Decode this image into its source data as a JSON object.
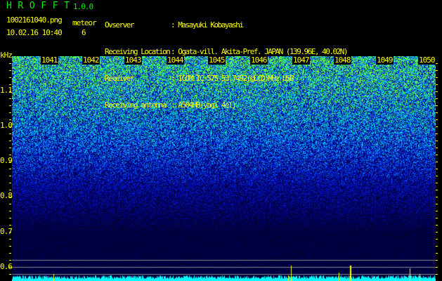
{
  "app": {
    "title": "HROFFT",
    "version": "1.0.0"
  },
  "file": {
    "name": "1002161040.png",
    "datetime": "10.02.16 10:40"
  },
  "meteor": {
    "label": "meteor",
    "count": "6"
  },
  "info": [
    {
      "key": "Ovserver",
      "value": ": Masayuki Kobayashi"
    },
    {
      "key": "Receiving Location",
      "value": ": Ogata-vill. Akita-Pref. JAPAN (139.96E, 40.02N)"
    },
    {
      "key": "Receiver",
      "value": ": ICOM IC-575 53.7492(@LCD)MHz USB"
    },
    {
      "key": "Receiving antenna",
      "value": ": A504HB(yagi 4el)"
    }
  ],
  "spectrogram": {
    "y_unit": "kHz",
    "y_ticks": [
      "1.1",
      "1.0",
      "0.9",
      "0.8",
      "0.7",
      "0.6"
    ],
    "time_labels": [
      "1041",
      "1042",
      "1043",
      "1044",
      "1045",
      "1046",
      "1047",
      "1048",
      "1049",
      "1050"
    ]
  }
}
